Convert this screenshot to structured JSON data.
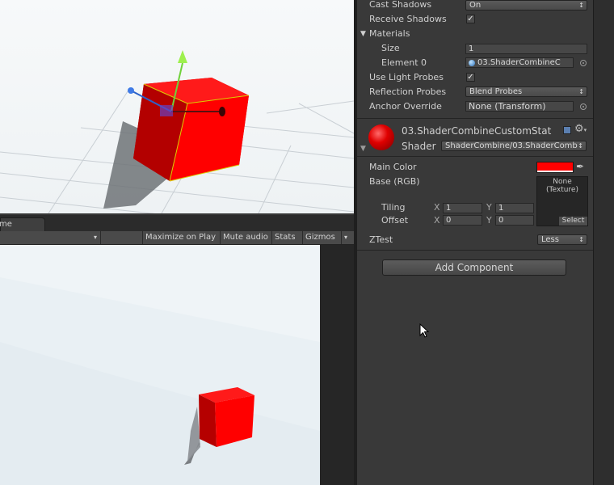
{
  "colors": {
    "accent_red": "#ff0000",
    "material_ball": "#e00000"
  },
  "scene": {
    "label": "scene-view"
  },
  "game": {
    "tab_label": "me",
    "toolbar": {
      "maximize_on_play": "Maximize on Play",
      "mute_audio": "Mute audio",
      "stats": "Stats",
      "gizmos": "Gizmos"
    }
  },
  "inspector": {
    "cast_shadows": {
      "label": "Cast Shadows",
      "value": "On"
    },
    "receive_shadows": {
      "label": "Receive Shadows",
      "checked": true
    },
    "materials": {
      "label": "Materials",
      "size_label": "Size",
      "size_value": "1",
      "element_label": "Element 0",
      "element_value": "03.ShaderCombineC"
    },
    "use_light_probes": {
      "label": "Use Light Probes",
      "checked": true
    },
    "reflection_probes": {
      "label": "Reflection Probes",
      "value": "Blend Probes"
    },
    "anchor_override": {
      "label": "Anchor Override",
      "value": "None (Transform)"
    },
    "material": {
      "name": "03.ShaderCombineCustomStat",
      "shader_label": "Shader",
      "shader_value": "ShaderCombine/03.ShaderComb"
    },
    "main_color": {
      "label": "Main Color",
      "color": "#ff0000"
    },
    "base_rgb": {
      "label": "Base (RGB)",
      "texture_none": "None",
      "texture_type": "(Texture)",
      "select_label": "Select"
    },
    "tiling": {
      "label": "Tiling",
      "x_label": "X",
      "x": "1",
      "y_label": "Y",
      "y": "1"
    },
    "offset": {
      "label": "Offset",
      "x_label": "X",
      "x": "0",
      "y_label": "Y",
      "y": "0"
    },
    "ztest": {
      "label": "ZTest",
      "value": "Less"
    },
    "add_component": "Add Component"
  },
  "icons": {
    "tab_menu": "menu-icon",
    "dropdown": "chevron-updown-icon",
    "picker": "object-picker-icon",
    "eyedropper": "eyedropper-icon",
    "settings": "gear-icon",
    "help": "book-icon",
    "collapse": "triangle-icon"
  }
}
